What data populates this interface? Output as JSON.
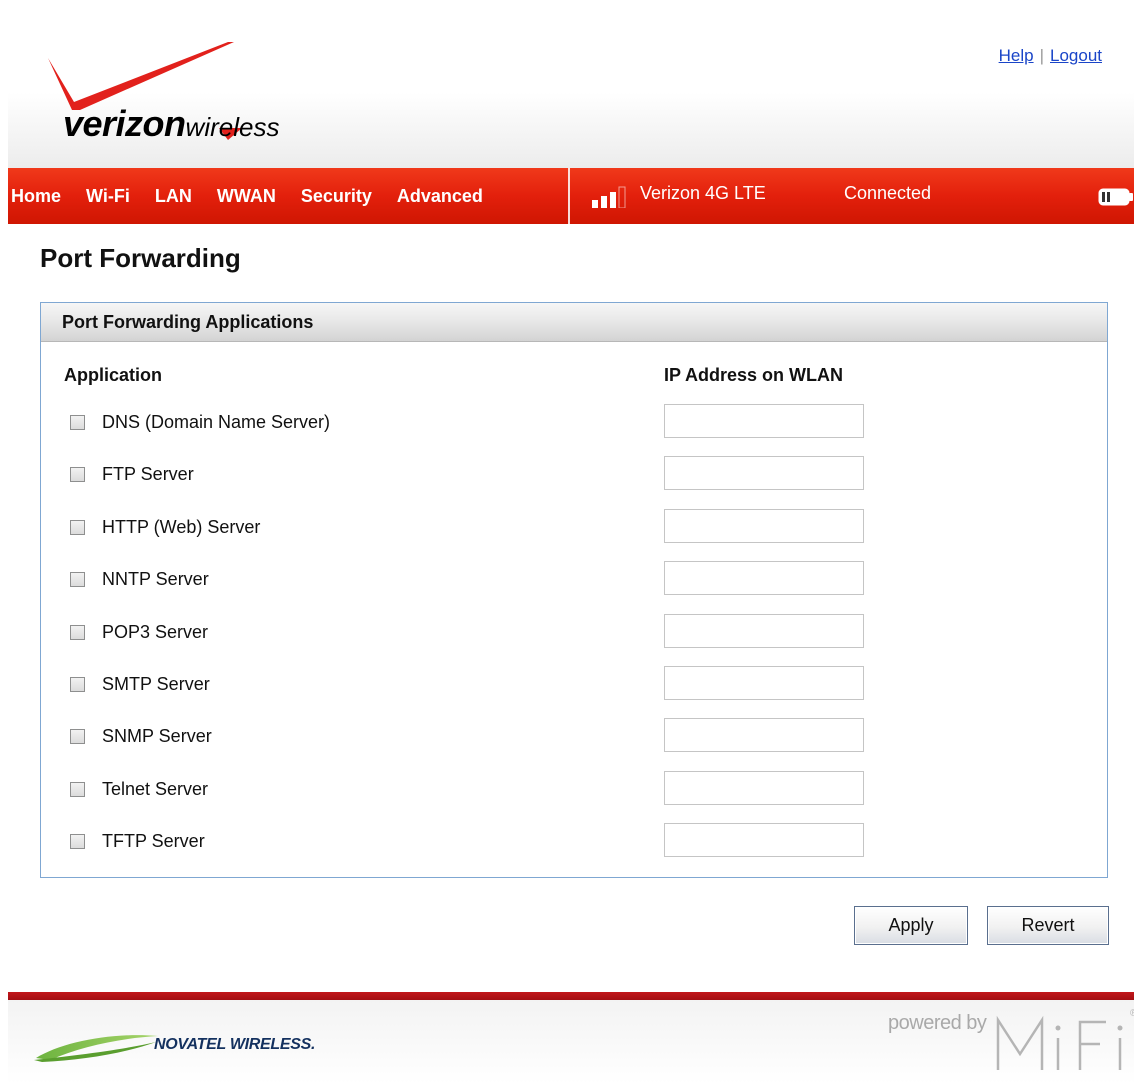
{
  "header": {
    "brand_bold": "verizon",
    "brand_suffix": "wireless",
    "help_link": "Help",
    "separator": "|",
    "logout_link": "Logout"
  },
  "nav": {
    "items": [
      "Home",
      "Wi-Fi",
      "LAN",
      "WWAN",
      "Security",
      "Advanced"
    ],
    "carrier": "Verizon  4G LTE",
    "connection_status": "Connected",
    "signal_bars_lit": 3,
    "signal_bars_total": 4
  },
  "page": {
    "title": "Port Forwarding"
  },
  "panel": {
    "title": "Port Forwarding Applications",
    "col_application": "Application",
    "col_ip": "IP Address on WLAN",
    "rows": [
      {
        "label": "DNS (Domain Name Server)",
        "checked": false,
        "ip": ""
      },
      {
        "label": "FTP Server",
        "checked": false,
        "ip": ""
      },
      {
        "label": "HTTP (Web) Server",
        "checked": false,
        "ip": ""
      },
      {
        "label": "NNTP Server",
        "checked": false,
        "ip": ""
      },
      {
        "label": "POP3 Server",
        "checked": false,
        "ip": ""
      },
      {
        "label": "SMTP Server",
        "checked": false,
        "ip": ""
      },
      {
        "label": "SNMP Server",
        "checked": false,
        "ip": ""
      },
      {
        "label": "Telnet Server",
        "checked": false,
        "ip": ""
      },
      {
        "label": "TFTP Server",
        "checked": false,
        "ip": ""
      }
    ]
  },
  "buttons": {
    "apply": "Apply",
    "revert": "Revert"
  },
  "footer": {
    "novatel": "NOVATEL WIRELESS.",
    "powered_by": "powered by",
    "mifi": "MiFi",
    "registered": "®"
  },
  "colors": {
    "nav_red": "#e3200c",
    "link_blue": "#1a45c8",
    "panel_border": "#7fa7d2",
    "footer_red": "#c2171b"
  }
}
